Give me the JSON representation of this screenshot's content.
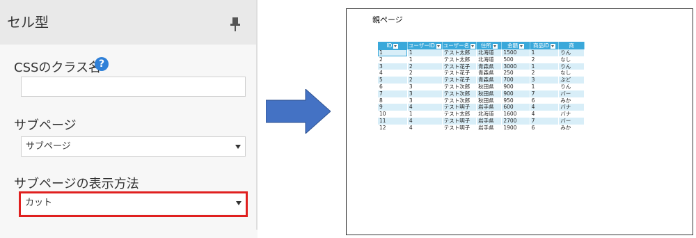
{
  "panel": {
    "title": "セル型",
    "pin_icon": "pin-icon",
    "css_class_label": "CSSのクラス名",
    "help_icon": "question-circle-icon",
    "help_glyph": "?",
    "css_class_value": "",
    "subpage_label": "サブページ",
    "subpage_value": "サブページ",
    "display_method_label": "サブページの表示方法",
    "display_method_value": "カット",
    "highlight_color": "#e0201f",
    "accent_color": "#2f80d8"
  },
  "arrow": {
    "icon": "right-arrow-icon",
    "color": "#4472c4"
  },
  "preview": {
    "title": "親ページ",
    "header_color": "#3aa8da",
    "stripe_color": "#d8eef8",
    "columns": [
      "ID",
      "ユーザーID",
      "ユーザー名",
      "住所",
      "金額",
      "商品ID",
      "商"
    ],
    "rows": [
      [
        "1",
        "1",
        "テスト太郎",
        "北海道",
        "1500",
        "1",
        "りん"
      ],
      [
        "2",
        "1",
        "テスト太郎",
        "北海道",
        "500",
        "2",
        "なし"
      ],
      [
        "3",
        "2",
        "テスト花子",
        "青森県",
        "3000",
        "1",
        "りん"
      ],
      [
        "4",
        "2",
        "テスト花子",
        "青森県",
        "250",
        "2",
        "なし"
      ],
      [
        "5",
        "2",
        "テスト花子",
        "青森県",
        "700",
        "3",
        "ぶど"
      ],
      [
        "6",
        "3",
        "テスト次郎",
        "秋田県",
        "900",
        "1",
        "りん"
      ],
      [
        "7",
        "3",
        "テスト次郎",
        "秋田県",
        "900",
        "7",
        "バー"
      ],
      [
        "8",
        "3",
        "テスト次郎",
        "秋田県",
        "950",
        "6",
        "みか"
      ],
      [
        "9",
        "4",
        "テスト明子",
        "岩手県",
        "600",
        "4",
        "バナ"
      ],
      [
        "10",
        "1",
        "テスト太郎",
        "北海道",
        "1600",
        "4",
        "バナ"
      ],
      [
        "11",
        "4",
        "テスト明子",
        "岩手県",
        "2700",
        "7",
        "バー"
      ],
      [
        "12",
        "4",
        "テスト明子",
        "岩手県",
        "1900",
        "6",
        "みか"
      ]
    ]
  }
}
